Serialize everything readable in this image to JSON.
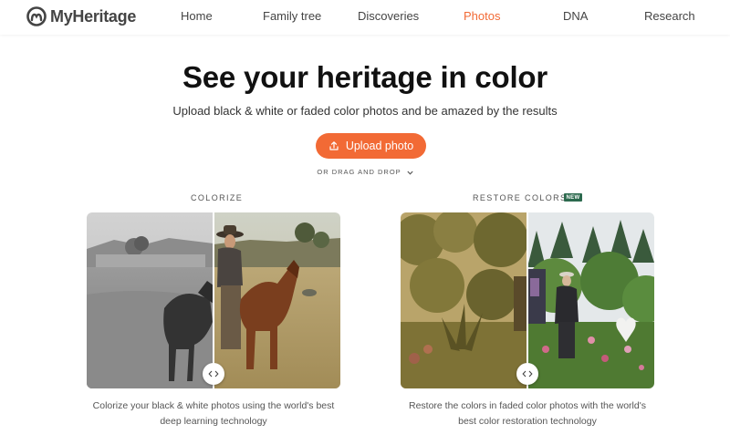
{
  "brand": {
    "name": "MyHeritage",
    "accent": "#f26a35"
  },
  "nav": {
    "items": [
      {
        "label": "Home",
        "active": false
      },
      {
        "label": "Family tree",
        "active": false
      },
      {
        "label": "Discoveries",
        "active": false
      },
      {
        "label": "Photos",
        "active": true
      },
      {
        "label": "DNA",
        "active": false
      },
      {
        "label": "Research",
        "active": false
      }
    ]
  },
  "hero": {
    "title": "See your heritage in color",
    "subtitle": "Upload black & white or faded color photos and be amazed by the results",
    "upload_label": "Upload photo",
    "upload_icon": "upload-icon",
    "drag_label": "OR DRAG AND DROP",
    "drag_icon": "chevron-down-icon"
  },
  "colorize": {
    "label": "COLORIZE",
    "caption_line1": "Colorize your black & white photos using the world's best",
    "caption_line2": "deep learning technology",
    "handle_icon": "compare-arrows-icon"
  },
  "restore": {
    "label": "RESTORE COLORS",
    "badge": "NEW",
    "badge_color": "#2c6a4e",
    "caption_line1": "Restore the colors in faded color photos with the world's",
    "caption_line2": "best color restoration technology",
    "handle_icon": "compare-arrows-icon"
  }
}
